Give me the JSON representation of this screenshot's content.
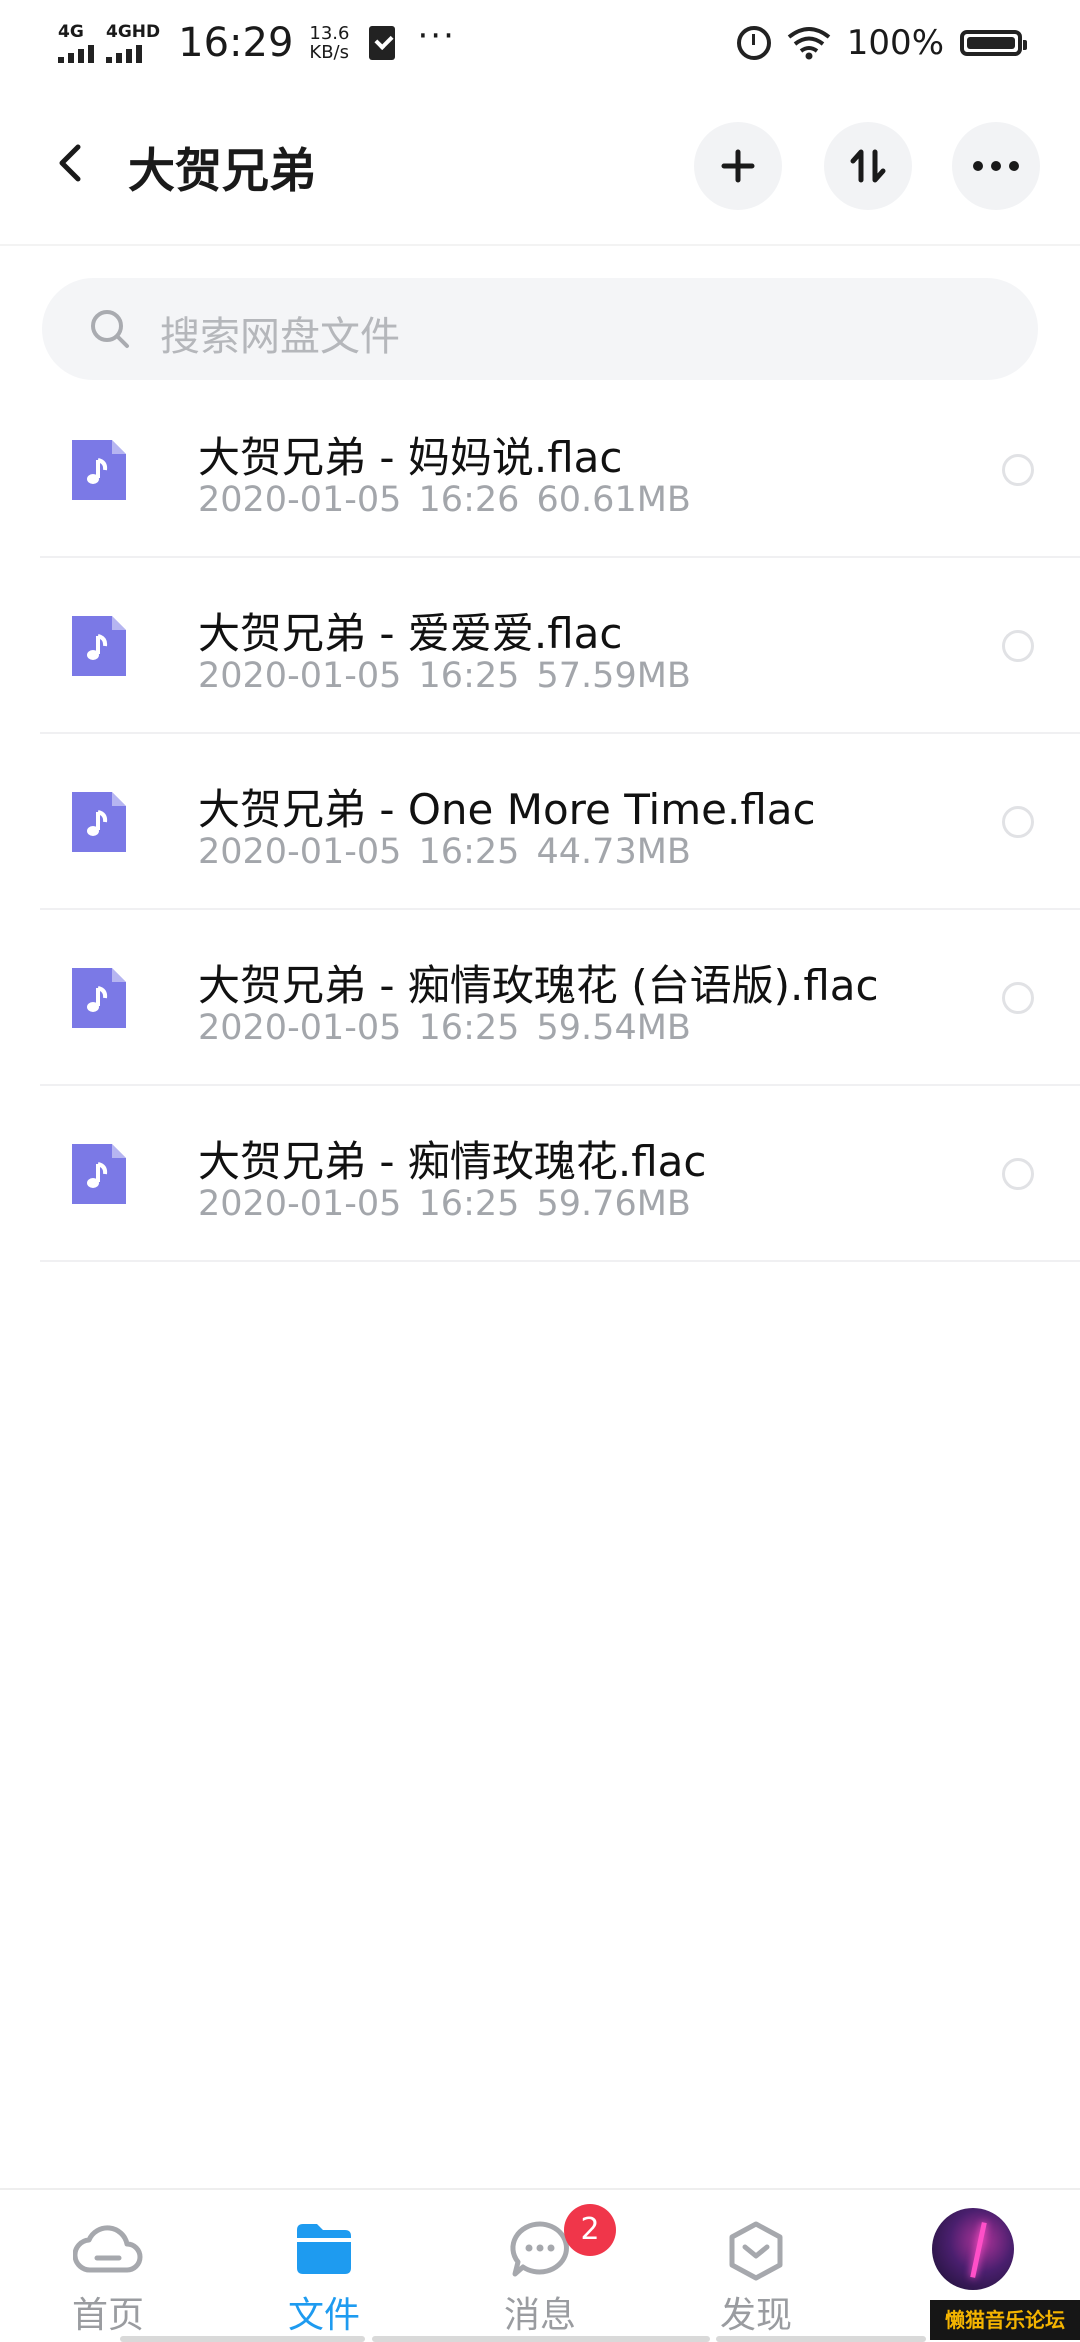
{
  "status_bar": {
    "network1": "4G",
    "network2": "4GHD",
    "time": "16:29",
    "speed_value": "13.6",
    "speed_unit": "KB/s",
    "more": "···",
    "battery": "100%"
  },
  "header": {
    "title": "大贺兄弟",
    "icons": [
      "back-icon",
      "plus-icon",
      "sort-icon",
      "more-icon"
    ]
  },
  "search": {
    "placeholder": "搜索网盘文件"
  },
  "files": [
    {
      "name": "大贺兄弟 - 妈妈说.flac",
      "meta": "2020-01-05  16:26  60.61MB"
    },
    {
      "name": "大贺兄弟 - 爱爱爱.flac",
      "meta": "2020-01-05  16:25  57.59MB"
    },
    {
      "name": "大贺兄弟 - One More Time.flac",
      "meta": "2020-01-05  16:25  44.73MB"
    },
    {
      "name": "大贺兄弟 - 痴情玫瑰花 (台语版).flac",
      "meta": "2020-01-05  16:25  59.54MB"
    },
    {
      "name": "大贺兄弟 - 痴情玫瑰花.flac",
      "meta": "2020-01-05  16:25  59.76MB"
    }
  ],
  "nav": {
    "items": [
      {
        "label": "首页",
        "icon": "cloud-icon"
      },
      {
        "label": "文件",
        "icon": "folder-icon"
      },
      {
        "label": "消息",
        "icon": "chat-icon",
        "badge": "2"
      },
      {
        "label": "发现",
        "icon": "discover-icon"
      }
    ]
  },
  "watermark": "懒猫音乐论坛",
  "colors": {
    "accent": "#1e9bf0",
    "file_icon": "#7b79e6",
    "badge": "#f0364a",
    "muted": "#a3a6ab"
  }
}
